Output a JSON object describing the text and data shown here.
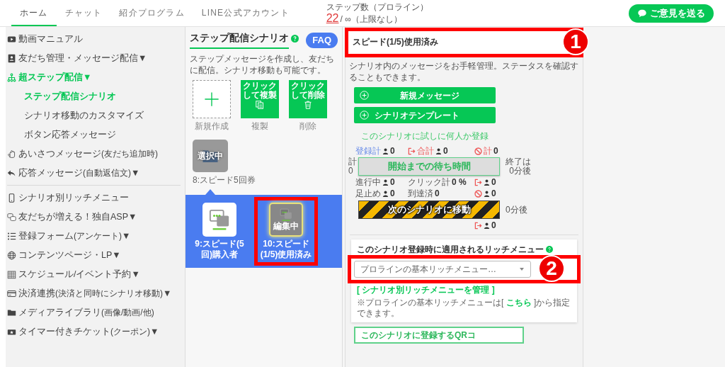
{
  "top_nav": {
    "tabs": [
      {
        "label": "ホーム",
        "selected": true
      },
      {
        "label": "チャット",
        "selected": false
      },
      {
        "label": "紹介プログラム",
        "selected": false
      },
      {
        "label": "LINE公式アカウント",
        "selected": false
      }
    ],
    "step_count": {
      "label": "ステップ数（プロライン）",
      "used": "22",
      "limit": "/ ∞（上限なし）"
    },
    "feedback_button": "ご意見を送る"
  },
  "sidebar": {
    "groups": [
      [
        {
          "label": "動画マニュアル",
          "expanded": false
        },
        {
          "label": "友だち管理・メッセージ配信",
          "caret": "▼",
          "expanded": false
        },
        {
          "label": "超ステップ配信",
          "caret": "▼",
          "expanded": true,
          "children": [
            {
              "label": "ステップ配信シナリオ",
              "selected": true
            },
            {
              "label": "シナリオ移動のカスタマイズ",
              "selected": false
            },
            {
              "label": "ボタン応答メッセージ",
              "selected": false
            }
          ]
        },
        {
          "label": "あいさつメッセージ",
          "note": "(友だち追加時)",
          "expanded": false
        },
        {
          "label": "応答メッセージ",
          "note": "(自動返信文)",
          "caret": "▼",
          "expanded": false
        }
      ],
      [
        {
          "label": "シナリオ別リッチメニュー",
          "expanded": false
        },
        {
          "label": "友だちが増える！独自ASP",
          "caret": "▼",
          "expanded": false
        },
        {
          "label": "登録フォーム",
          "note": "(アンケート)",
          "caret": "▼",
          "expanded": false
        },
        {
          "label": "コンテンツページ・LP",
          "caret": "▼",
          "expanded": false
        },
        {
          "label": "スケジュール/イベント予約",
          "caret": "▼",
          "expanded": false
        },
        {
          "label": "決済連携",
          "note": "(決済と同時にシナリオ移動)",
          "caret": "▼",
          "expanded": false
        },
        {
          "label": "メディアライブラリ",
          "note": "(画像/動画/他)",
          "expanded": false
        },
        {
          "label": "タイマー付きチケット",
          "note": "(クーポン)",
          "caret": "▼",
          "expanded": false
        }
      ]
    ]
  },
  "scenario_panel": {
    "title": "ステップ配信シナリオ",
    "faq": "FAQ",
    "description": "ステップメッセージを作成し、友だちに配信。シナリオ移動も可能です。",
    "actions": [
      {
        "kind": "new",
        "caption": "新規作成"
      },
      {
        "kind": "copy",
        "button_text": "クリックして複製",
        "caption": "複製"
      },
      {
        "kind": "delete",
        "button_text": "クリックして削除",
        "caption": "削除"
      }
    ],
    "folders": [
      {
        "badge": "選択中",
        "name": "8:スピード5回券",
        "selected": true
      }
    ],
    "scenarios": [
      {
        "name": "9:スピード(5回)購入者",
        "editing": false,
        "highlighted": false
      },
      {
        "name": "10:スピード(1/5)使用済み",
        "badge": "編集中",
        "editing": true,
        "highlighted": true
      }
    ]
  },
  "scenario_detail": {
    "name": "スピード(1/5)使用済み",
    "highlighted": true,
    "callout": "1",
    "description": "シナリオ内のメッセージをお手軽管理。ステータスを確認することもできます。",
    "buttons": [
      "新規メッセージ",
      "シナリオテンプレート"
    ],
    "trial_link": "このシナリオに試しに何人か登録",
    "flow": {
      "top": [
        {
          "kind": "registered",
          "label": "登録計",
          "person": true,
          "value": "0"
        },
        {
          "kind": "exit",
          "label": "合計",
          "person": true,
          "value": "0"
        },
        {
          "kind": "blocked",
          "label": "計",
          "person": false,
          "value": "0"
        }
      ],
      "side_label": "計",
      "side_value": "0",
      "start_step": "開始までの待ち時間",
      "end_label": "終了は",
      "end_value": "0分後",
      "middle": [
        {
          "kind": "plain",
          "label": "進行中",
          "person": true,
          "value": "0"
        },
        {
          "kind": "plain",
          "label": "クリック計",
          "person": false,
          "value": "0 %"
        },
        {
          "kind": "exit",
          "person": true,
          "value": "0"
        }
      ],
      "bottom": [
        {
          "kind": "plain",
          "label": "足止め",
          "person": true,
          "value": "0"
        },
        {
          "kind": "plain",
          "label": "到達済",
          "person": false,
          "value": "0"
        },
        {
          "kind": "blocked",
          "person": true,
          "value": "0"
        }
      ],
      "move_step": "次のシナリオに移動",
      "move_after": "0分後",
      "exit": {
        "kind": "exit",
        "person": true,
        "value": "0"
      }
    },
    "rich_menu": {
      "title": "このシナリオ登録時に適用されるリッチメニュー",
      "select": "プロラインの基本リッチメニュー…",
      "highlighted": true,
      "callout": "2",
      "manage_link": "[ シナリオ別リッチメニューを管理 ]",
      "note_before": "※プロラインの基本リッチメニューは[ ",
      "note_link": "こちら",
      "note_after": " ]から指定できます。"
    },
    "qr_button": "このシナリオに登録するQRコ"
  }
}
